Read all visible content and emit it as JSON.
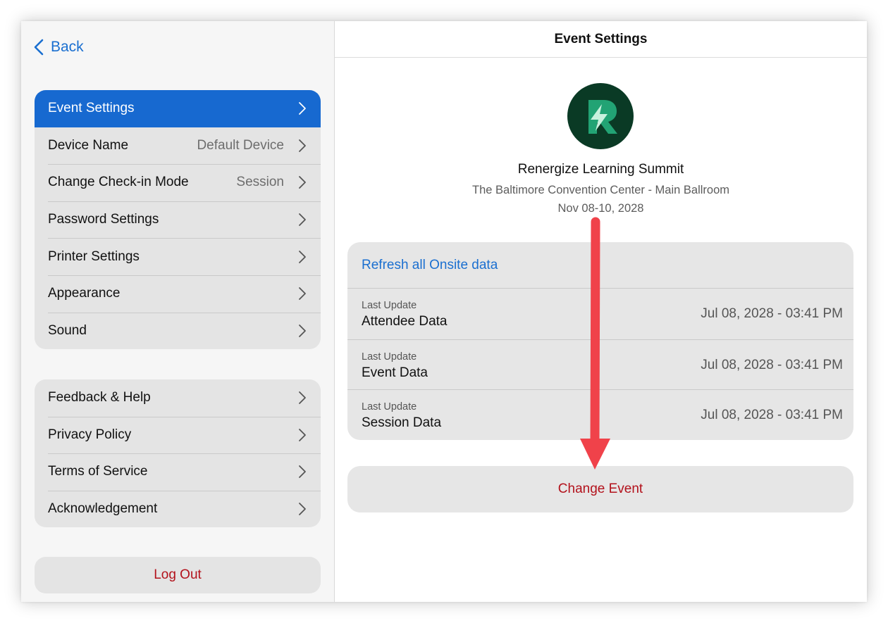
{
  "sidebar": {
    "back_label": "Back",
    "settings_group": [
      {
        "label": "Event Settings",
        "value": ""
      },
      {
        "label": "Device Name",
        "value": "Default Device"
      },
      {
        "label": "Change Check-in Mode",
        "value": "Session"
      },
      {
        "label": "Password Settings",
        "value": ""
      },
      {
        "label": "Printer Settings",
        "value": ""
      },
      {
        "label": "Appearance",
        "value": ""
      },
      {
        "label": "Sound",
        "value": ""
      }
    ],
    "info_group": [
      {
        "label": "Feedback & Help"
      },
      {
        "label": "Privacy Policy"
      },
      {
        "label": "Terms of Service"
      },
      {
        "label": "Acknowledgement"
      }
    ],
    "logout_label": "Log Out"
  },
  "main": {
    "title": "Event Settings",
    "event": {
      "name": "Renergize Learning Summit",
      "venue": "The Baltimore Convention Center - Main Ballroom",
      "dates": "Nov 08-10, 2028"
    },
    "refresh_label": "Refresh all Onsite data",
    "updates": [
      {
        "caption": "Last Update",
        "label": "Attendee Data",
        "timestamp": "Jul 08, 2028 - 03:41 PM"
      },
      {
        "caption": "Last Update",
        "label": "Event Data",
        "timestamp": "Jul 08, 2028 - 03:41 PM"
      },
      {
        "caption": "Last Update",
        "label": "Session Data",
        "timestamp": "Jul 08, 2028 - 03:41 PM"
      }
    ],
    "change_event_label": "Change Event"
  },
  "colors": {
    "accent_blue": "#1769d0",
    "link_blue": "#1a6fd0",
    "destructive_red": "#b3121c",
    "annotation_arrow": "#f0424a",
    "logo_bg": "#0a3a25"
  }
}
